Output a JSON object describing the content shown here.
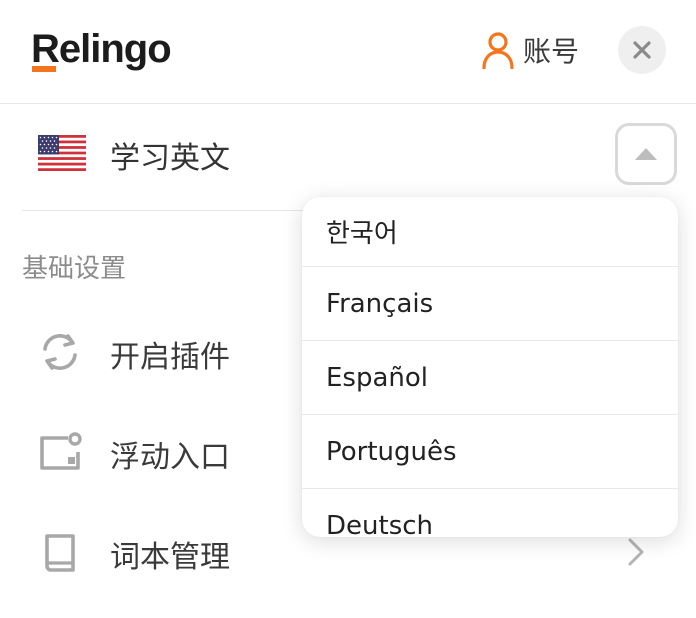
{
  "brand": {
    "name": "Relingo",
    "accent_color": "#f5751d",
    "text_color": "#1c1c1c"
  },
  "header": {
    "account_label": "账号",
    "account_icon": "user-icon",
    "close_icon": "close-icon"
  },
  "language": {
    "flag_icon": "us-flag-icon",
    "label": "学习英文",
    "toggle_icon": "chevron-up-icon",
    "options": [
      "한국어",
      "Français",
      "Español",
      "Português",
      "Deutsch"
    ]
  },
  "settings": {
    "section_title": "基础设置",
    "items": [
      {
        "label": "开启插件",
        "icon": "sync-icon"
      },
      {
        "label": "浮动入口",
        "icon": "floating-window-icon"
      },
      {
        "label": "词本管理",
        "icon": "book-icon",
        "chevron_icon": "chevron-right-icon"
      }
    ]
  }
}
